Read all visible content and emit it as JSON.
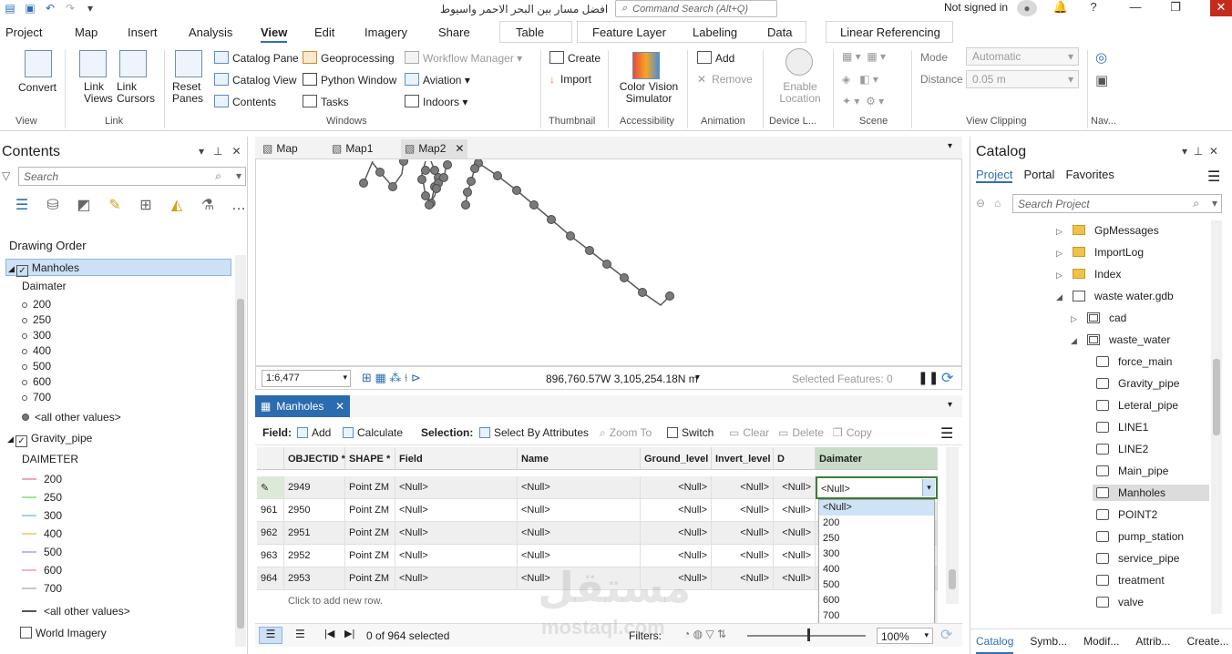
{
  "titlebar": {
    "title": "افضل مسار بين البحر الاحمر واسيوط",
    "command_search_placeholder": "Command Search (Alt+Q)",
    "signin": "Not signed in"
  },
  "ribbon_tabs": [
    "Project",
    "Map",
    "Insert",
    "Analysis",
    "View",
    "Edit",
    "Imagery",
    "Share"
  ],
  "context_tabs": {
    "table": "Table",
    "feature_layer": "Feature Layer",
    "labeling": "Labeling",
    "data": "Data",
    "linear_referencing": "Linear Referencing"
  },
  "ribbon": {
    "view_group": {
      "convert": "Convert",
      "label": "View"
    },
    "link_group": {
      "link_views": "Link Views",
      "link_cursors": "Link Cursors",
      "label": "Link"
    },
    "windows_group": {
      "reset_panes": "Reset Panes",
      "catalog_pane": "Catalog Pane",
      "catalog_view": "Catalog View",
      "contents": "Contents",
      "geoprocessing": "Geoprocessing",
      "python_window": "Python Window",
      "tasks": "Tasks",
      "workflow_manager": "Workflow Manager",
      "aviation": "Aviation",
      "indoors": "Indoors",
      "label": "Windows"
    },
    "thumbnail_group": {
      "create": "Create",
      "import": "Import",
      "label": "Thumbnail"
    },
    "accessibility_group": {
      "color_vision": "Color Vision Simulator",
      "label": "Accessibility"
    },
    "animation_group": {
      "add": "Add",
      "remove": "Remove",
      "label": "Animation"
    },
    "device_group": {
      "enable_location": "Enable Location",
      "label": "Device L..."
    },
    "scene_group": {
      "label": "Scene"
    },
    "clipping_group": {
      "mode_label": "Mode",
      "mode_value": "Automatic",
      "distance_label": "Distance",
      "distance_value": "0.05 m",
      "label": "View Clipping"
    },
    "nav_group": {
      "label": "Nav..."
    }
  },
  "contents": {
    "title": "Contents",
    "search_placeholder": "Search",
    "drawing_order": "Drawing Order",
    "manholes": {
      "name": "Manholes",
      "field": "Daimater",
      "values": [
        "200",
        "250",
        "300",
        "400",
        "500",
        "600",
        "700"
      ],
      "other": "<all other values>"
    },
    "gravity": {
      "name": "Gravity_pipe",
      "field": "DAIMETER",
      "values": [
        "200",
        "250",
        "300",
        "400",
        "500",
        "600",
        "700"
      ],
      "colors": [
        "#f2a7b5",
        "#a6e3a1",
        "#9fd3f2",
        "#f6d48d",
        "#c3b8ef",
        "#f3b3d1",
        "#c9c9c9"
      ],
      "other": "<all other values>"
    },
    "world_imagery": "World Imagery"
  },
  "map_tabs": [
    "Map",
    "Map1",
    "Map2"
  ],
  "map_status": {
    "scale": "1:6,477",
    "coords": "896,760.57W 3,105,254.18N m",
    "selected": "Selected Features: 0"
  },
  "table": {
    "tab": "Manholes",
    "field_label": "Field:",
    "add": "Add",
    "calculate": "Calculate",
    "selection_label": "Selection:",
    "select_by_attr": "Select By Attributes",
    "zoom_to": "Zoom To",
    "switch": "Switch",
    "clear": "Clear",
    "delete": "Delete",
    "copy": "Copy",
    "columns": [
      "OBJECTID *",
      "SHAPE *",
      "Field",
      "Name",
      "Ground_level",
      "Invert_level",
      "D",
      "Daimater"
    ],
    "rows": [
      {
        "idx": "",
        "oid": "2949",
        "shape": "Point ZM",
        "field": "<Null>",
        "name": "<Null>",
        "ground": "<Null>",
        "invert": "<Null>",
        "d": "<Null>",
        "daim": "<Null>"
      },
      {
        "idx": "961",
        "oid": "2950",
        "shape": "Point ZM",
        "field": "<Null>",
        "name": "<Null>",
        "ground": "<Null>",
        "invert": "<Null>",
        "d": "<Null>",
        "daim": ""
      },
      {
        "idx": "962",
        "oid": "2951",
        "shape": "Point ZM",
        "field": "<Null>",
        "name": "<Null>",
        "ground": "<Null>",
        "invert": "<Null>",
        "d": "<Null>",
        "daim": ""
      },
      {
        "idx": "963",
        "oid": "2952",
        "shape": "Point ZM",
        "field": "<Null>",
        "name": "<Null>",
        "ground": "<Null>",
        "invert": "<Null>",
        "d": "<Null>",
        "daim": ""
      },
      {
        "idx": "964",
        "oid": "2953",
        "shape": "Point ZM",
        "field": "<Null>",
        "name": "<Null>",
        "ground": "<Null>",
        "invert": "<Null>",
        "d": "<Null>",
        "daim": ""
      }
    ],
    "add_row": "Click to add new row.",
    "dropdown": [
      "<Null>",
      "200",
      "250",
      "300",
      "400",
      "500",
      "600",
      "700"
    ],
    "footer_selected": "0 of 964 selected",
    "filters": "Filters:",
    "zoom": "100%"
  },
  "catalog": {
    "title": "Catalog",
    "tabs": [
      "Project",
      "Portal",
      "Favorites"
    ],
    "search_placeholder": "Search Project",
    "folders": [
      "GpMessages",
      "ImportLog",
      "Index"
    ],
    "gdb": "waste water.gdb",
    "datasets": [
      "cad",
      "waste_water"
    ],
    "items": [
      "force_main",
      "Gravity_pipe",
      "Leteral_pipe",
      "LINE1",
      "LINE2",
      "Main_pipe",
      "Manholes",
      "POINT2",
      "pump_station",
      "service_pipe",
      "treatment",
      "valve"
    ],
    "selected_item": "Manholes",
    "bottom_tabs": [
      "Catalog",
      "Symb...",
      "Modif...",
      "Attrib...",
      "Create..."
    ]
  },
  "watermark": {
    "arabic": "مستقل",
    "latin": "mostaql.com"
  }
}
